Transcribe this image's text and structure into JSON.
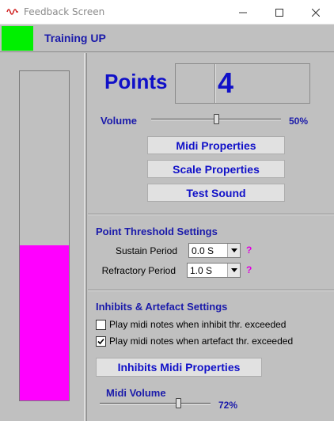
{
  "window": {
    "title": "Feedback Screen"
  },
  "header": {
    "mode": "Training UP",
    "indicator_color": "#00f000"
  },
  "feedback_bar": {
    "level": 0.47,
    "fill_color": "#ff00ff"
  },
  "points": {
    "label": "Points",
    "value": "4"
  },
  "volume": {
    "label": "Volume",
    "value_text": "50%",
    "level": 0.5
  },
  "buttons": {
    "midi_properties": "Midi Properties",
    "scale_properties": "Scale Properties",
    "test_sound": "Test Sound"
  },
  "threshold": {
    "title": "Point Threshold Settings",
    "sustain_label": "Sustain Period",
    "sustain_value": "0.0 S",
    "refractory_label": "Refractory Period",
    "refractory_value": "1.0 S",
    "help": "?"
  },
  "inhibits": {
    "title": "Inhibits & Artefact Settings",
    "checkbox_inhibit_label": "Play midi notes when inhibit thr. exceeded",
    "checkbox_inhibit_checked": false,
    "checkbox_artefact_label": "Play midi notes when artefact thr. exceeded",
    "checkbox_artefact_checked": true,
    "midi_button": "Inhibits Midi Properties",
    "midi_volume_label": "Midi Volume",
    "midi_volume_text": "72%",
    "midi_volume_level": 0.72
  }
}
